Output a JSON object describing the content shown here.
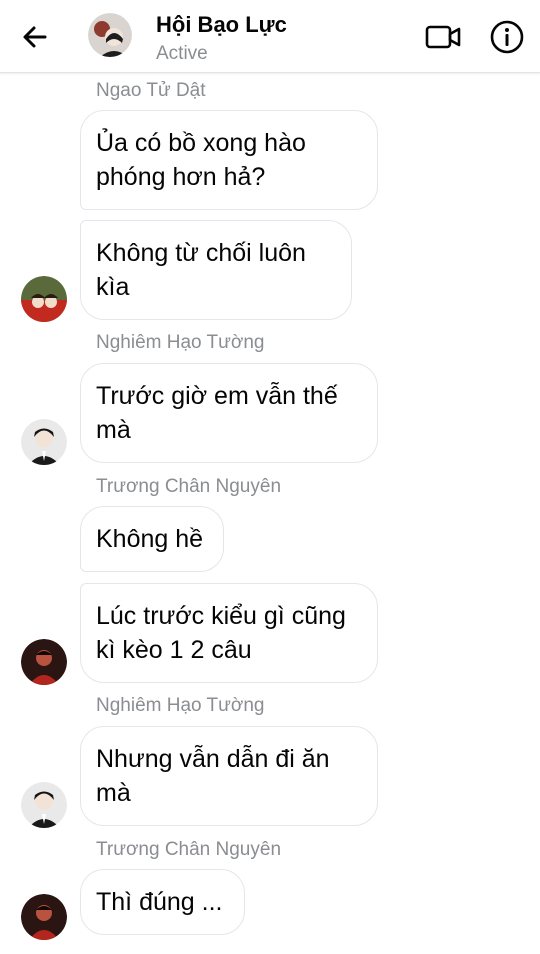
{
  "header": {
    "title": "Hội Bạo Lực",
    "status": "Active",
    "icons": [
      "back-arrow-icon",
      "video-call-icon",
      "info-icon"
    ]
  },
  "messages": [
    {
      "sender": "Ngao Tử Dật",
      "text": "Ủa có bồ xong hào phóng hơn hả?"
    },
    {
      "sender": "",
      "text": "Không từ chối luôn kìa"
    },
    {
      "sender": "Nghiêm Hạo Tường",
      "text": "Trước giờ em vẫn thế mà"
    },
    {
      "sender": "Trương Chân Nguyên",
      "text": "Không hề"
    },
    {
      "sender": "",
      "text": "Lúc trước kiểu gì cũng kì kèo 1 2 câu"
    },
    {
      "sender": "Nghiêm Hạo Tường",
      "text": "Nhưng vẫn dẫn đi ăn mà"
    },
    {
      "sender": "Trương Chân Nguyên",
      "text": "Thì đúng ..."
    }
  ],
  "colors": {
    "text": "#050505",
    "secondary_text": "#8a8d91",
    "bubble_border": "#e4e6eb",
    "avatar_red": "#b3261e",
    "avatar_dark": "#1c1c1c"
  }
}
